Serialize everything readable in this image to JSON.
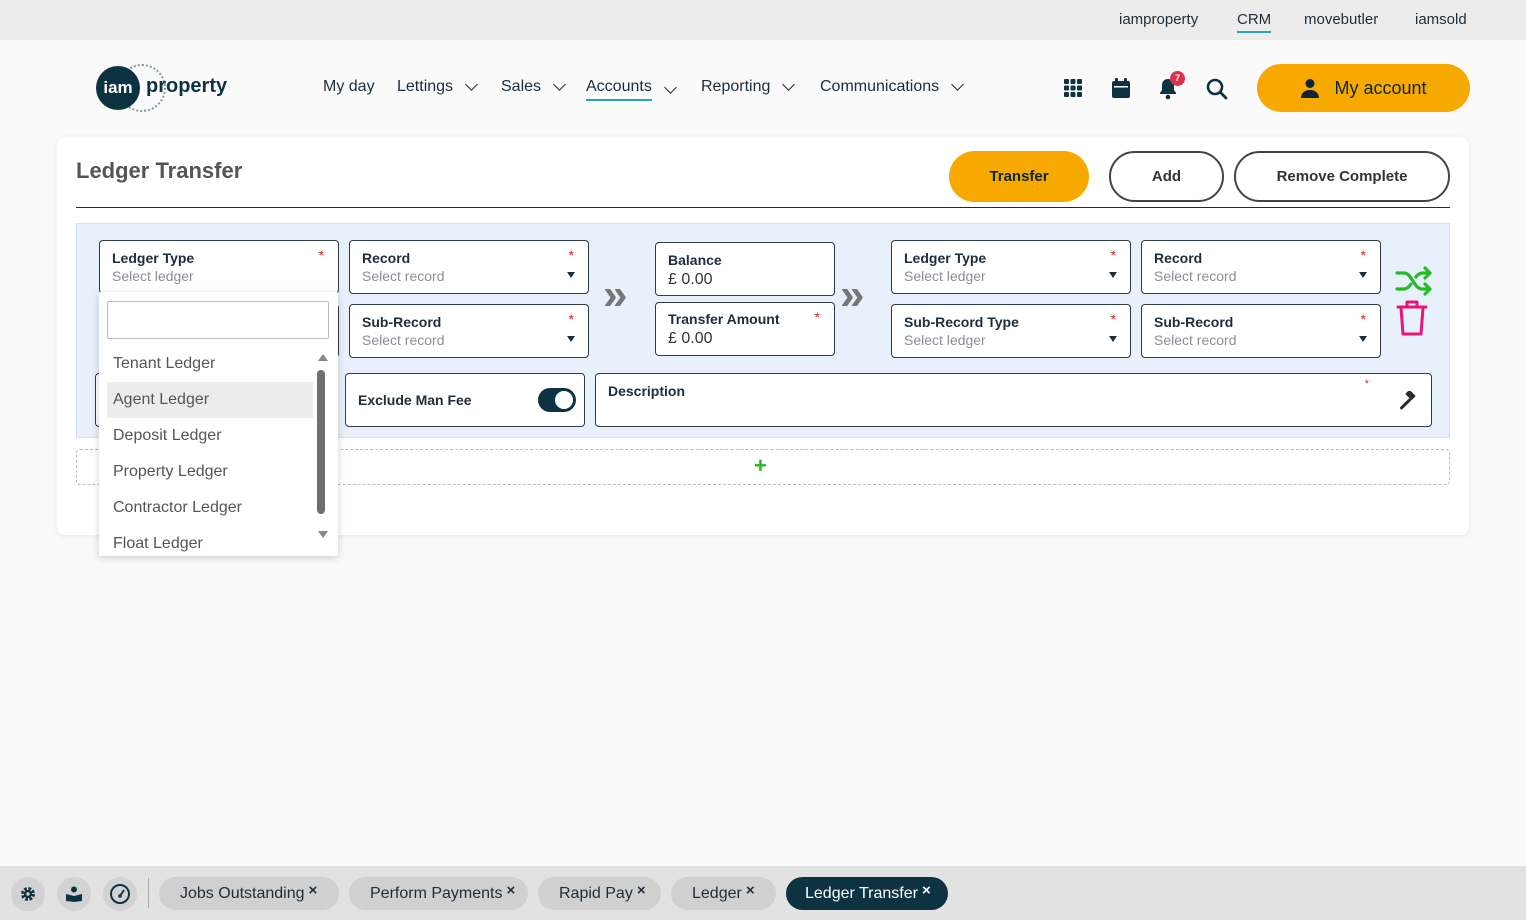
{
  "top_links": [
    "iamproperty",
    "CRM",
    "movebutler",
    "iamsold"
  ],
  "logo": {
    "mark": "iam",
    "word": "property"
  },
  "nav": [
    "My day",
    "Lettings",
    "Sales",
    "Accounts",
    "Reporting",
    "Communications"
  ],
  "header_icons": [
    "apps-grid-icon",
    "calendar-icon",
    "bell-icon",
    "search-icon"
  ],
  "notification_count": "7",
  "my_account_label": "My account",
  "page": {
    "title": "Ledger Transfer",
    "buttons": {
      "transfer": "Transfer",
      "add": "Add",
      "remove_complete": "Remove Complete"
    }
  },
  "form": {
    "from_ledger_type": {
      "label": "Ledger Type",
      "placeholder": "Select ledger",
      "required": "*"
    },
    "from_record": {
      "label": "Record",
      "placeholder": "Select record",
      "required": "*"
    },
    "from_sub_record": {
      "label": "Sub-Record",
      "placeholder": "Select record",
      "required": "*"
    },
    "balance": {
      "label": "Balance",
      "value": "£ 0.00"
    },
    "transfer_amount": {
      "label": "Transfer Amount",
      "value": "£ 0.00",
      "required": "*"
    },
    "to_ledger_type": {
      "label": "Ledger Type",
      "placeholder": "Select ledger",
      "required": "*"
    },
    "to_record": {
      "label": "Record",
      "placeholder": "Select record",
      "required": "*"
    },
    "to_sub_record_type": {
      "label": "Sub-Record Type",
      "placeholder": "Select ledger",
      "required": "*"
    },
    "to_sub_record": {
      "label": "Sub-Record",
      "placeholder": "Select record",
      "required": "*"
    },
    "exclude_man_fee": {
      "label": "Exclude Man Fee",
      "on": true
    },
    "description": {
      "label": "Description",
      "required": "*"
    },
    "arrows": "»",
    "add_row": "+"
  },
  "dropdown": {
    "search_value": "",
    "options": [
      "Tenant Ledger",
      "Agent Ledger",
      "Deposit Ledger",
      "Property Ledger",
      "Contractor Ledger",
      "Float Ledger"
    ],
    "highlighted": "Agent Ledger"
  },
  "bottom_icons": [
    "settings-icon",
    "knowledge-icon",
    "dashboard-gauge-icon"
  ],
  "bottom_tabs": [
    {
      "label": "Jobs Outstanding",
      "close": "×"
    },
    {
      "label": "Perform Payments",
      "close": "×"
    },
    {
      "label": "Rapid Pay",
      "close": "×"
    },
    {
      "label": "Ledger",
      "close": "×"
    },
    {
      "label": "Ledger Transfer",
      "close": "×",
      "active": true
    }
  ],
  "colors": {
    "accent": "#f7a900",
    "navy": "#0d3342",
    "shuffle": "#22bb22",
    "delete": "#e6157a",
    "required": "#e02020"
  }
}
